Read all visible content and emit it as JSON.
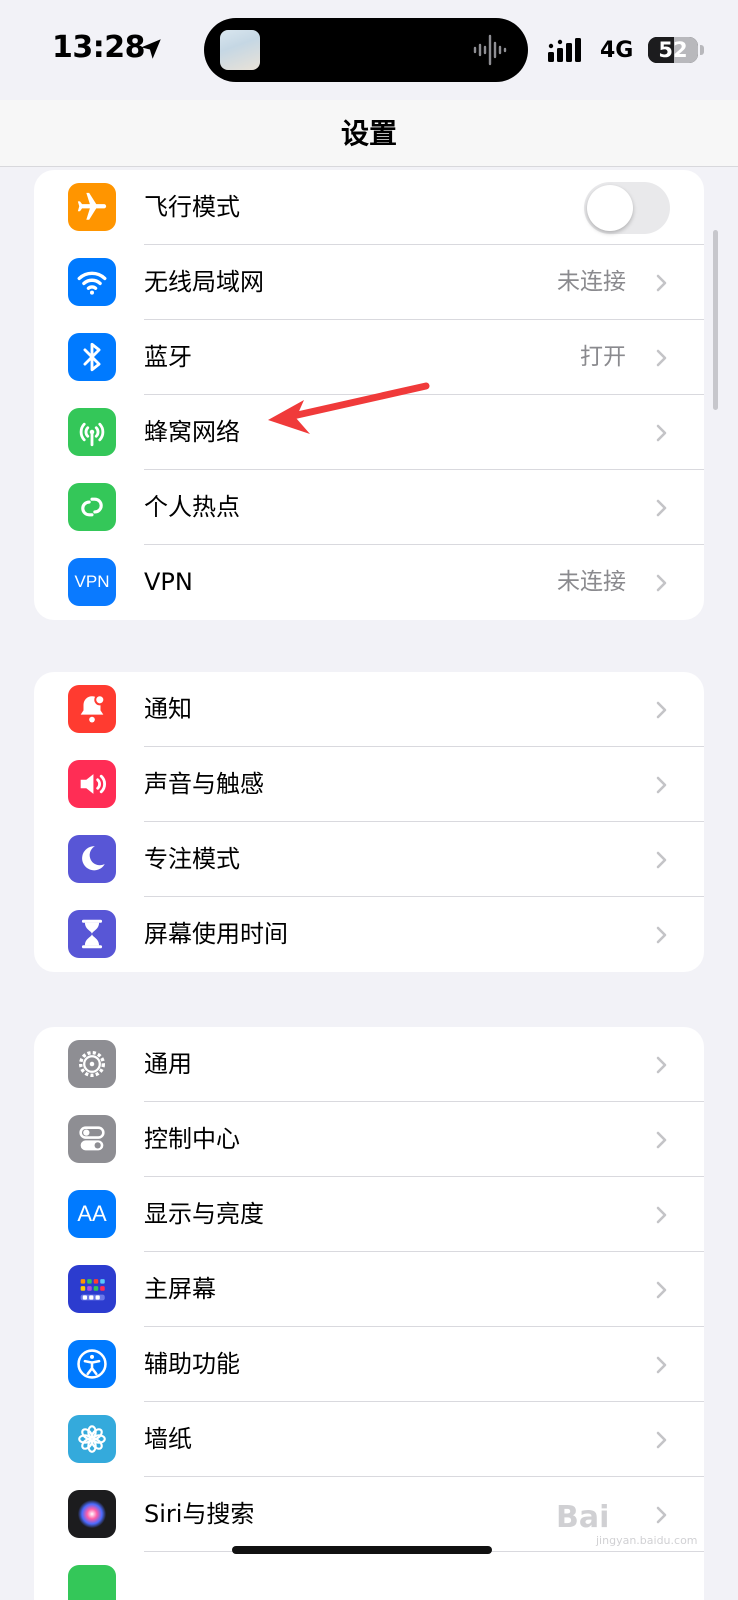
{
  "status_bar": {
    "time": "13:28",
    "network": "4G",
    "battery": "52",
    "battery_level": 0.52,
    "location_icon": "location-arrow-icon",
    "signal_icon": "cellular-signal-icon"
  },
  "nav": {
    "title": "设置"
  },
  "groups": [
    {
      "items": [
        {
          "label": "飞行模式",
          "icon": "airplane-icon",
          "color": "#ff9500",
          "toggle": false
        },
        {
          "label": "无线局域网",
          "icon": "wifi-icon",
          "color": "#007aff",
          "value": "未连接"
        },
        {
          "label": "蓝牙",
          "icon": "bluetooth-icon",
          "color": "#007aff",
          "value": "打开"
        },
        {
          "label": "蜂窝网络",
          "icon": "cellular-antenna-icon",
          "color": "#34c759"
        },
        {
          "label": "个人热点",
          "icon": "hotspot-icon",
          "color": "#34c759"
        },
        {
          "label": "VPN",
          "icon": "vpn-icon",
          "icon_text": "VPN",
          "color": "#0a7aff",
          "value": "未连接"
        }
      ]
    },
    {
      "items": [
        {
          "label": "通知",
          "icon": "notification-bell-icon",
          "color": "#ff3b30"
        },
        {
          "label": "声音与触感",
          "icon": "speaker-icon",
          "color": "#ff2d55"
        },
        {
          "label": "专注模式",
          "icon": "moon-icon",
          "color": "#5856d6"
        },
        {
          "label": "屏幕使用时间",
          "icon": "hourglass-icon",
          "color": "#5856d6"
        }
      ]
    },
    {
      "items": [
        {
          "label": "通用",
          "icon": "gear-icon",
          "color": "#8e8e93"
        },
        {
          "label": "控制中心",
          "icon": "control-center-icon",
          "color": "#8e8e93"
        },
        {
          "label": "显示与亮度",
          "icon": "display-brightness-icon",
          "icon_text": "AA",
          "color": "#007aff"
        },
        {
          "label": "主屏幕",
          "icon": "home-screen-icon",
          "color": "#2c3ccf"
        },
        {
          "label": "辅助功能",
          "icon": "accessibility-icon",
          "color": "#007aff"
        },
        {
          "label": "墙纸",
          "icon": "wallpaper-flower-icon",
          "color": "#34aadc"
        },
        {
          "label": "Siri与搜索",
          "icon": "siri-icon",
          "color": "#1c1c1e"
        }
      ]
    }
  ],
  "annotation": {
    "icon": "red-arrow-icon",
    "color": "#f03a3a"
  },
  "watermark": {
    "text": "Bai",
    "sub": "jingyan.baidu.com"
  }
}
